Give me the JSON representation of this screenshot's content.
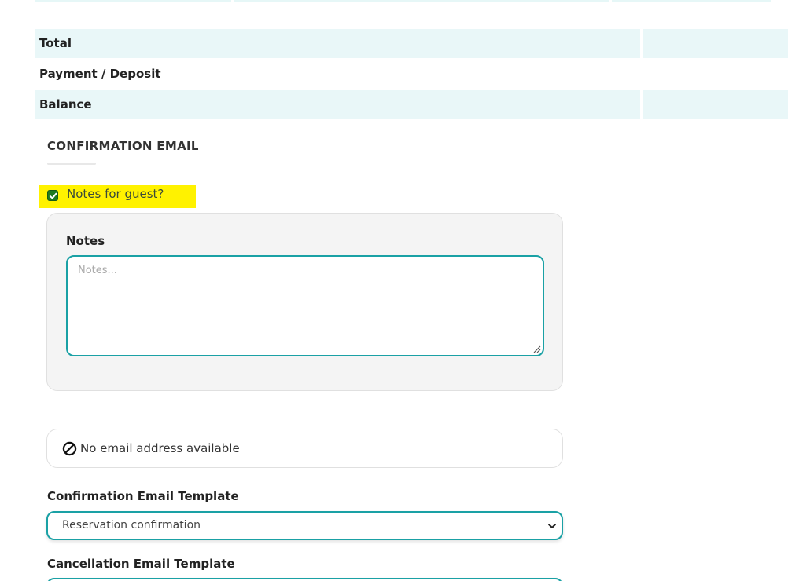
{
  "totals": {
    "rows": [
      {
        "label": "Total"
      },
      {
        "label": "Payment / Deposit"
      },
      {
        "label": "Balance"
      }
    ]
  },
  "confirmation_email": {
    "section_title": "CONFIRMATION EMAIL",
    "notes_checkbox_label": "Notes for guest?",
    "notes_checked": true,
    "notes_title": "Notes",
    "notes_placeholder": "Notes...",
    "notes_value": "",
    "no_email_text": "No email address available",
    "confirmation_template_label": "Confirmation Email Template",
    "confirmation_template_value": "Reservation confirmation",
    "cancellation_template_label": "Cancellation Email Template",
    "cancellation_template_value": ""
  },
  "colors": {
    "row_shade": "#e9f7f8",
    "accent": "#1aa1a5",
    "checkbox": "#1f7a1f",
    "highlight": "#fff200",
    "panel_bg": "#f4f4f4"
  },
  "icons": {
    "checkbox": "check-icon",
    "no_email": "ban-icon",
    "select": "chevron-down-icon",
    "resize": "resize-handle-icon"
  }
}
